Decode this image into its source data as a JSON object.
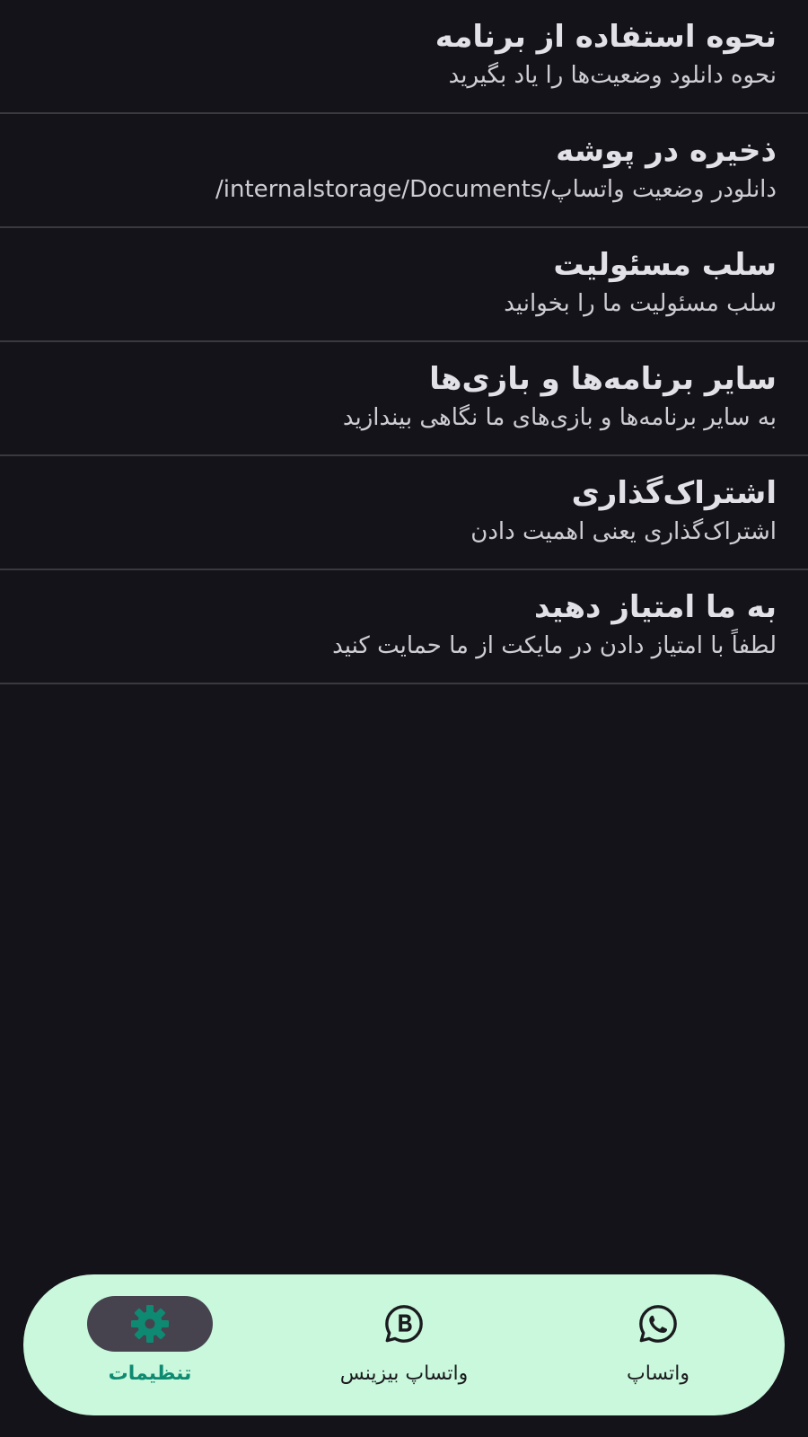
{
  "settings": {
    "items": [
      {
        "title": "نحوه استفاده از برنامه",
        "subtitle": "نحوه دانلود وضعیت‌ها را یاد بگیرید"
      },
      {
        "title": "ذخیره در پوشه",
        "subtitle": "دانلودر وضعیت واتساپ/internalstorage/Documents/"
      },
      {
        "title": "سلب مسئولیت",
        "subtitle": "سلب مسئولیت ما را بخوانید"
      },
      {
        "title": "سایر برنامه‌ها و بازی‌ها",
        "subtitle": "به سایر برنامه‌ها و بازی‌های ما نگاهی بیندازید"
      },
      {
        "title": "اشتراک‌گذاری",
        "subtitle": "اشتراک‌گذاری یعنی اهمیت دادن"
      },
      {
        "title": "به ما امتیاز دهید",
        "subtitle": "لطفاً با امتیاز دادن در مایکت از ما حمایت کنید"
      }
    ]
  },
  "bottom_nav": {
    "items": [
      {
        "label": "واتساپ",
        "icon": "whatsapp-icon",
        "active": false
      },
      {
        "label": "واتساپ بیزینس",
        "icon": "whatsapp-business-icon",
        "active": false
      },
      {
        "label": "تنظیمات",
        "icon": "gear-icon",
        "active": true
      }
    ]
  },
  "colors": {
    "background": "#15131a",
    "nav_background": "#c9f8dc",
    "active_accent": "#0f8a72",
    "active_pill": "#46434f"
  }
}
